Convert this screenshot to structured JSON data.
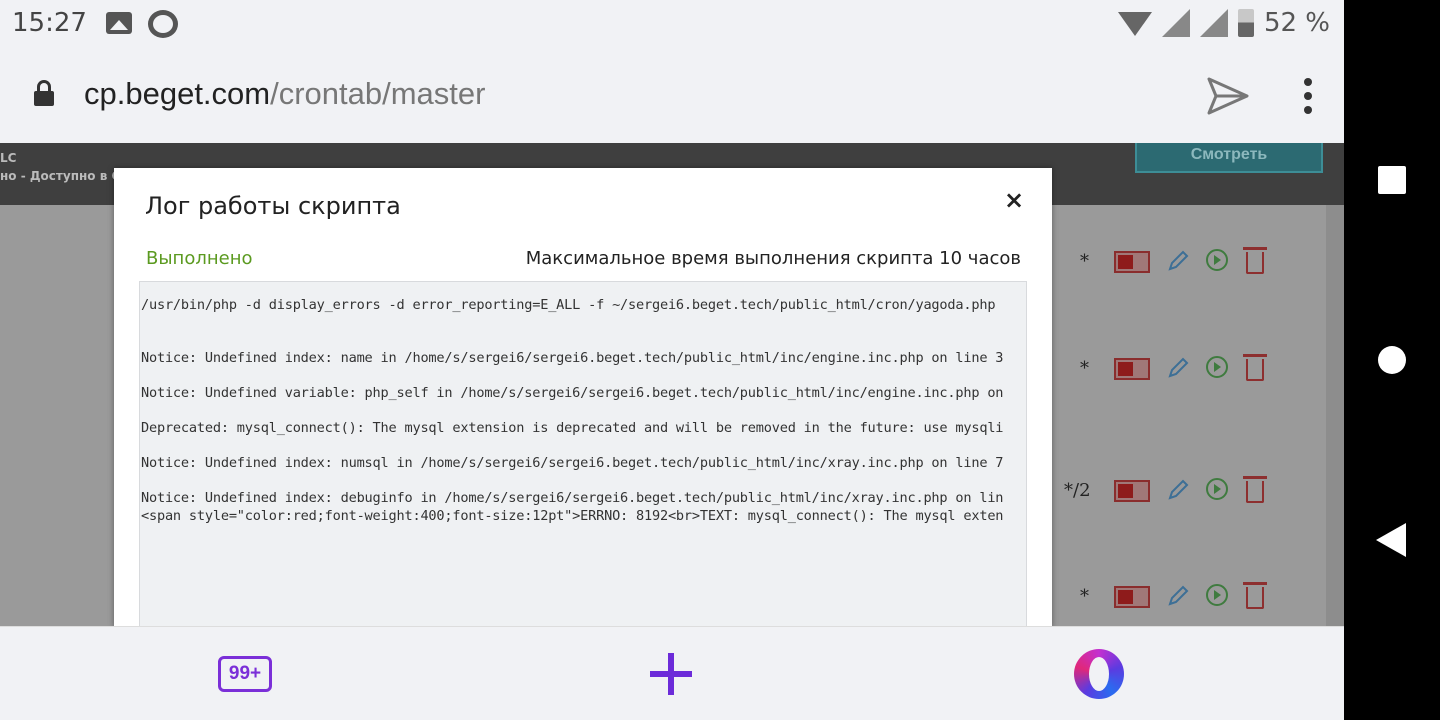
{
  "status_bar": {
    "time": "15:27",
    "battery": "52 %",
    "icons": [
      "image-icon",
      "chat-icon",
      "wifi-icon",
      "signal-icon",
      "signal-icon",
      "battery-icon"
    ]
  },
  "url_bar": {
    "host": "cp.beget.com",
    "path": "/crontab/master"
  },
  "background_page": {
    "header_line1": "LC",
    "header_line2": "но - Доступно в G",
    "view_button": "Смотреть",
    "cron_rows": [
      {
        "schedule": "*"
      },
      {
        "schedule": "*"
      },
      {
        "schedule": "*/2"
      },
      {
        "schedule": "*"
      }
    ]
  },
  "modal": {
    "title": "Лог работы скрипта",
    "close": "×",
    "status": "Выполнено",
    "max_time": "Максимальное время выполнения скрипта 10 часов",
    "log_lines": [
      "/usr/bin/php -d display_errors -d error_reporting=E_ALL -f ~/sergei6.beget.tech/public_html/cron/yagoda.php",
      "Notice: Undefined index: name in /home/s/sergei6/sergei6.beget.tech/public_html/inc/engine.inc.php on line 3",
      "Notice: Undefined variable: php_self in /home/s/sergei6/sergei6.beget.tech/public_html/inc/engine.inc.php on",
      "Deprecated: mysql_connect(): The mysql extension is deprecated and will be removed in the future: use mysqli",
      "Notice: Undefined index: numsql in /home/s/sergei6/sergei6.beget.tech/public_html/inc/xray.inc.php on line 7",
      "Notice: Undefined index: debuginfo in /home/s/sergei6/sergei6.beget.tech/public_html/inc/xray.inc.php on lin",
      "<span style=\"color:red;font-weight:400;font-size:12pt\">ERRNO: 8192<br>TEXT: mysql_connect(): The mysql exten"
    ]
  },
  "bottom_bar": {
    "tabs_count": "99+"
  },
  "colors": {
    "status_ok": "#5b9a20",
    "opera_purple": "#7b2fd8",
    "log_background": "#eff1f3"
  }
}
